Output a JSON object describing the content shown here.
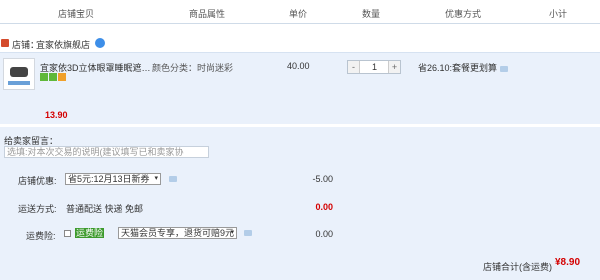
{
  "columns": [
    "店铺宝贝",
    "商品属性",
    "单价",
    "数量",
    "优惠方式",
    "小计"
  ],
  "shop": {
    "label": "店铺：",
    "name": "宜家依旗舰店"
  },
  "item": {
    "title": "宜家依3D立体眼罩睡眠遮…",
    "attribute": "颜色分类：时尚迷彩",
    "unit_price": "40.00",
    "quantity": "1",
    "qty_minus": "-",
    "qty_plus": "+",
    "promotion": "省26.10:套餐更划算",
    "subtotal": "13.90"
  },
  "note": {
    "label": "给卖家留言：",
    "placeholder": "选填:对本次交易的说明(建议填写已和卖家协"
  },
  "shop_coupon": {
    "label": "店铺优惠:",
    "selected": "省5元:12月13日新券",
    "amount": "-5.00"
  },
  "shipping": {
    "label": "运送方式:",
    "method": "普通配送 快递 免邮",
    "amount": "0.00"
  },
  "insurance": {
    "label": "运费险:",
    "tag": "运费险",
    "selected": "天猫会员专享，退货可赔9元",
    "amount": "0.00"
  },
  "total": {
    "label": "店铺合计(含运费)",
    "value": "¥8.90"
  },
  "colors": {
    "price_red": "#d40000",
    "row_bg": "#eaf1fb",
    "accent_blue": "#3d8ee8"
  }
}
